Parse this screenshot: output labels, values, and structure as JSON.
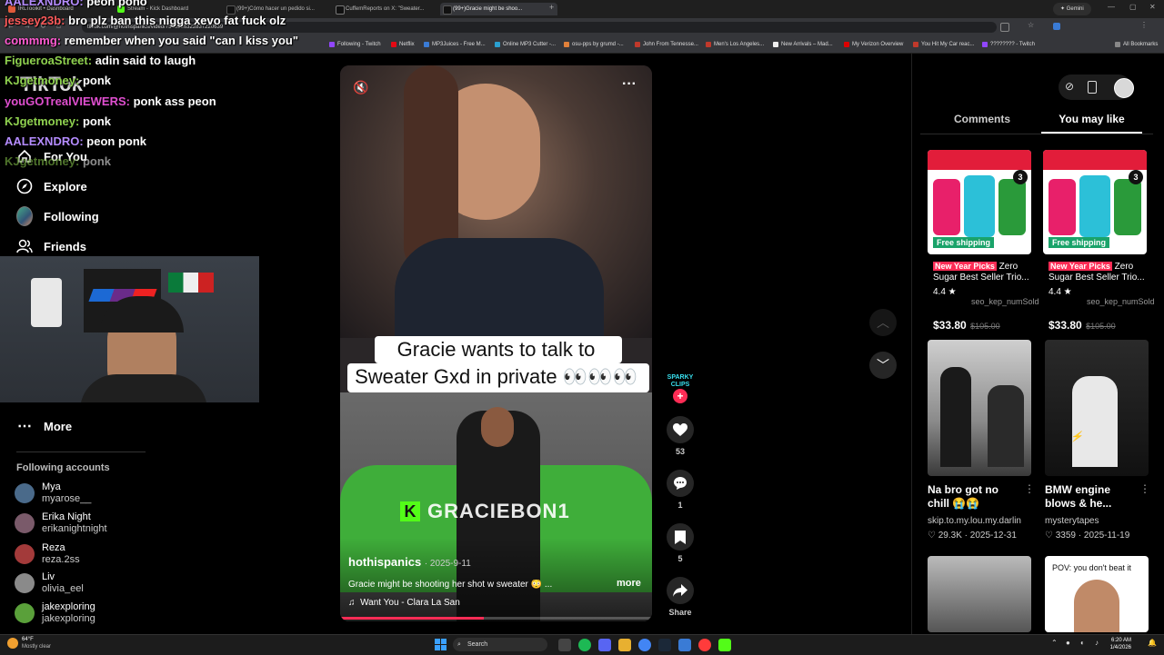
{
  "browser": {
    "tabs": [
      {
        "label": "IRLToolkit • Dashboard",
        "active": false
      },
      {
        "label": "Stream - Kick Dashboard",
        "active": false
      },
      {
        "label": "(99+)Cómo hacer un pedido si...",
        "active": false
      },
      {
        "label": "CuffemReports on X: \"Sweater...",
        "active": false
      },
      {
        "label": "(99+)Gracie might be shoo...",
        "active": true
      }
    ],
    "gemini_label": "Gemini",
    "url": "tiktok.com/@hothispanics/video/7548936322837220639",
    "bookmarks": [
      "Following - Twitch",
      "Netflix",
      "MP3Juices - Free M...",
      "Online MP3 Cutter -...",
      "osu-pps by grumd -...",
      "John From Tennesse...",
      "Men's Los Angeles...",
      "New Arrivals – Mad...",
      "My Verizon Overview",
      "You Hit My Car reac...",
      "???????? - Twitch",
      "All Bookmarks"
    ]
  },
  "chat": [
    {
      "user": "AALEXNDRO:",
      "msg": "peon pono",
      "color": "#b58cff"
    },
    {
      "user": "jessey23b:",
      "msg": "bro plz ban this nigga xevo fat fuck olz",
      "color": "#ff5b5b"
    },
    {
      "user": "commmg:",
      "msg": "remember when you said \"can I kiss you\"",
      "color": "#ff5bd2"
    },
    {
      "user": "FigueroaStreet:",
      "msg": "adin said to laugh",
      "color": "#8fd14f"
    },
    {
      "user": "KJgetmoney:",
      "msg": "ponk",
      "color": "#8fd14f"
    },
    {
      "user": "youGOTrealVIEWERS:",
      "msg": "ponk ass peon",
      "color": "#e04fd0"
    },
    {
      "user": "KJgetmoney:",
      "msg": "ponk",
      "color": "#8fd14f"
    },
    {
      "user": "AALEXNDRO:",
      "msg": "peon ponk",
      "color": "#b58cff"
    },
    {
      "user": "KJgetmoney:",
      "msg": "ponk",
      "color": "#8fd14f"
    }
  ],
  "sidebar": {
    "logo": "TikTok",
    "nav": [
      {
        "label": "For You",
        "icon": "home-icon"
      },
      {
        "label": "Explore",
        "icon": "compass-icon"
      },
      {
        "label": "Following",
        "icon": "following-icon"
      },
      {
        "label": "Friends",
        "icon": "friends-icon"
      },
      {
        "label": "More",
        "icon": "more-icon"
      }
    ],
    "following_title": "Following accounts",
    "accounts": [
      {
        "name": "Mya",
        "handle": "myarose__",
        "color": "#4a6a8a"
      },
      {
        "name": "Erika Night",
        "handle": "erikanightnight",
        "color": "#7a5a6a"
      },
      {
        "name": "Reza",
        "handle": "reza.2ss",
        "color": "#a33a3a"
      },
      {
        "name": "Liv",
        "handle": "olivia_eel",
        "color": "#8a8a8a"
      },
      {
        "name": "jakexploring",
        "handle": "jakexploring",
        "color": "#5aa03a"
      }
    ]
  },
  "video": {
    "caption_line1": "Gracie wants to talk to",
    "caption_line2": "Sweater Gxd in private 👀👀👀",
    "watermark": "GRACIEBON1",
    "author": "hothispanics",
    "date": "· 2025-9-11",
    "description": "Gracie might be shooting her shot w sweater 😳 ...",
    "more": "more",
    "music": "Want You - Clara La San",
    "progress": 0.46
  },
  "actions": {
    "creator_badge": "SPARKY CLIPS",
    "likes": "53",
    "comments": "1",
    "saves": "5",
    "share": "Share"
  },
  "right_panel": {
    "tab_comments": "Comments",
    "tab_you_may_like": "You may like",
    "products": [
      {
        "badge": "Free shipping",
        "tag": "New Year Picks",
        "title": "Zero Sugar Best Seller Trio...",
        "rating": "4.4 ★",
        "sold": "seo_kep_numSold",
        "price": "$33.80",
        "old_price": "$105.00",
        "pack": "3"
      },
      {
        "badge": "Free shipping",
        "tag": "New Year Picks",
        "title": "Zero Sugar Best Seller Trio...",
        "rating": "4.4 ★",
        "sold": "seo_kep_numSold",
        "price": "$33.80",
        "old_price": "$105.00",
        "pack": "3"
      }
    ],
    "videos": [
      {
        "title": "Na bro got no chill",
        "emojis": "😭😭",
        "author": "skip.to.my.lou.my.darlin",
        "likes": "♡ 29.3K",
        "date": "· 2025-12-31"
      },
      {
        "title": "BMW engine blows & he...",
        "emojis": "",
        "author": "mysterytapes",
        "likes": "♡ 3359",
        "date": "· 2025-11-19"
      }
    ],
    "bottom_caption": "POV: you don't beat it"
  },
  "taskbar": {
    "weather": "64°F",
    "weather_desc": "Mostly clear",
    "search": "Search",
    "time": "6:20 AM",
    "date": "1/4/2026"
  }
}
